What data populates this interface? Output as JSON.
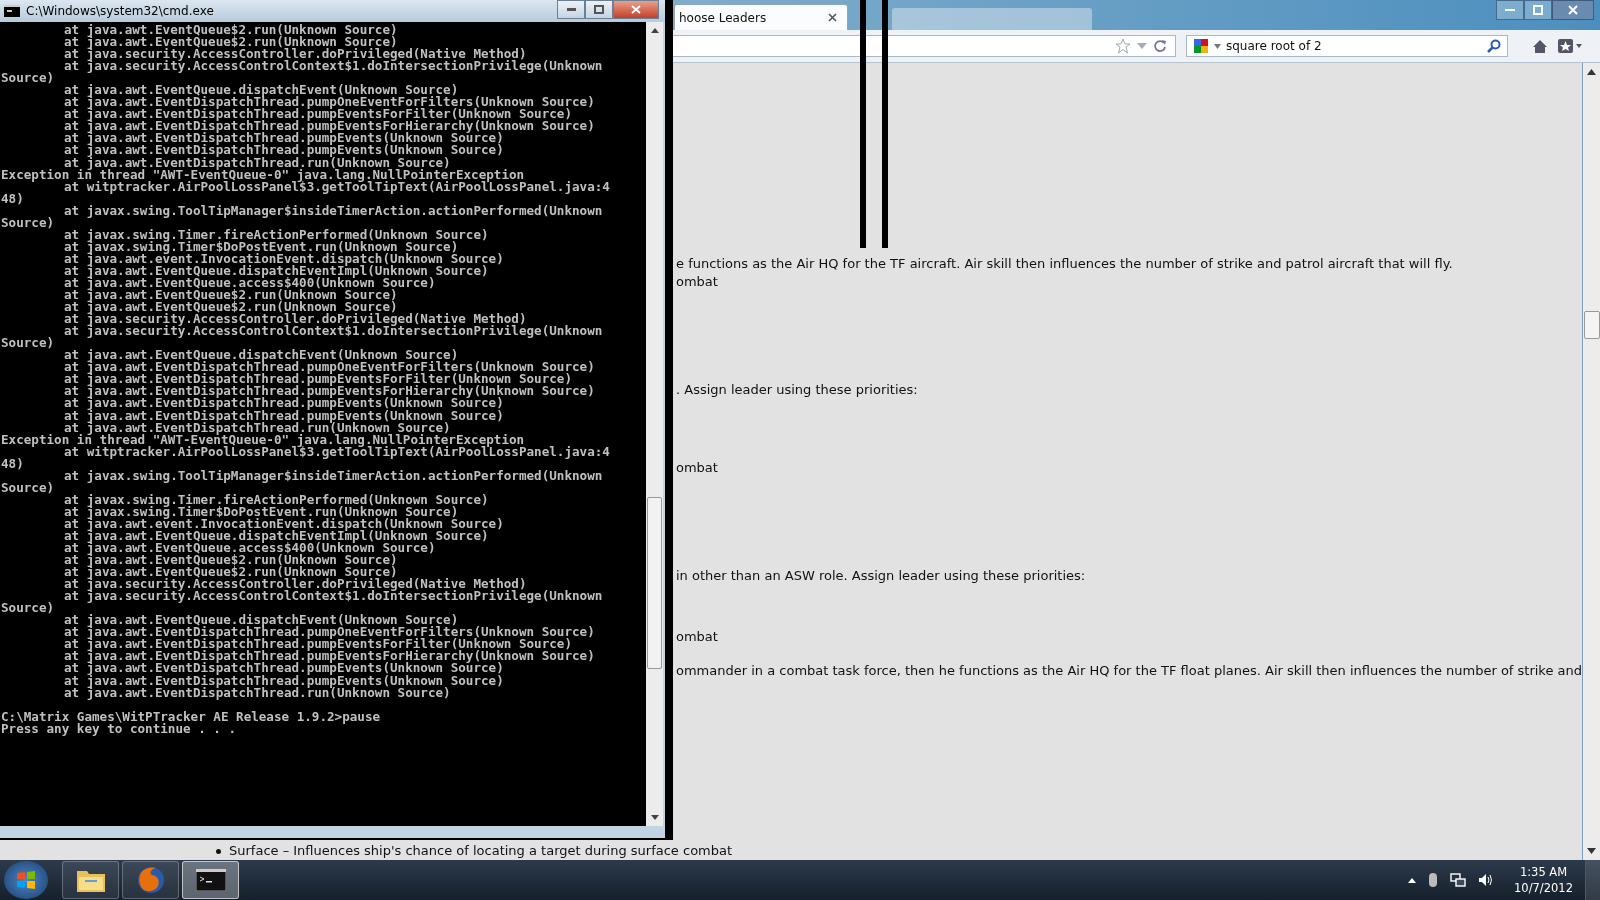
{
  "browser": {
    "tab": {
      "label": "hoose Leaders",
      "selected": true
    },
    "search_field": {
      "value": "square root of 2"
    },
    "page_lines": [
      {
        "text": "e functions as the Air HQ for the TF aircraft. Air skill then influences the number of strike and patrol aircraft that will fly."
      },
      {
        "text": "ombat"
      },
      {
        "text": ". Assign leader using these priorities:"
      },
      {
        "text": "ombat"
      },
      {
        "text": "in other than an ASW role. Assign leader using these priorities:"
      },
      {
        "text": "ombat"
      },
      {
        "text": "ommander in a combat task force, then he functions as the Air HQ for the TF float planes. Air skill then influences the number of strike and"
      }
    ],
    "bullet": {
      "text": "Surface – Influences ship's chance of locating a target during surface combat"
    }
  },
  "console_window": {
    "title": "C:\\Windows\\system32\\cmd.exe",
    "lines": [
      {
        "kind": "frame",
        "text": "at java.awt.EventQueue$2.run(Unknown Source)"
      },
      {
        "kind": "frame",
        "text": "at java.awt.EventQueue$2.run(Unknown Source)"
      },
      {
        "kind": "frame",
        "text": "at java.security.AccessController.doPrivileged(Native Method)"
      },
      {
        "kind": "frame",
        "text": "at java.security.AccessControlContext$1.doIntersectionPrivilege(Unknown"
      },
      {
        "kind": "plain",
        "text": "Source)"
      },
      {
        "kind": "frame",
        "text": "at java.awt.EventQueue.dispatchEvent(Unknown Source)"
      },
      {
        "kind": "frame",
        "text": "at java.awt.EventDispatchThread.pumpOneEventForFilters(Unknown Source)"
      },
      {
        "kind": "frame",
        "text": "at java.awt.EventDispatchThread.pumpEventsForFilter(Unknown Source)"
      },
      {
        "kind": "frame",
        "text": "at java.awt.EventDispatchThread.pumpEventsForHierarchy(Unknown Source)"
      },
      {
        "kind": "frame",
        "text": "at java.awt.EventDispatchThread.pumpEvents(Unknown Source)"
      },
      {
        "kind": "frame",
        "text": "at java.awt.EventDispatchThread.pumpEvents(Unknown Source)"
      },
      {
        "kind": "frame",
        "text": "at java.awt.EventDispatchThread.run(Unknown Source)"
      },
      {
        "kind": "plain",
        "text": "Exception in thread \"AWT-EventQueue-0\" java.lang.NullPointerException"
      },
      {
        "kind": "frame",
        "text": "at witptracker.AirPoolLossPanel$3.getToolTipText(AirPoolLossPanel.java:4"
      },
      {
        "kind": "plain",
        "text": "48)"
      },
      {
        "kind": "frame",
        "text": "at javax.swing.ToolTipManager$insideTimerAction.actionPerformed(Unknown"
      },
      {
        "kind": "plain",
        "text": "Source)"
      },
      {
        "kind": "frame",
        "text": "at javax.swing.Timer.fireActionPerformed(Unknown Source)"
      },
      {
        "kind": "frame",
        "text": "at javax.swing.Timer$DoPostEvent.run(Unknown Source)"
      },
      {
        "kind": "frame",
        "text": "at java.awt.event.InvocationEvent.dispatch(Unknown Source)"
      },
      {
        "kind": "frame",
        "text": "at java.awt.EventQueue.dispatchEventImpl(Unknown Source)"
      },
      {
        "kind": "frame",
        "text": "at java.awt.EventQueue.access$400(Unknown Source)"
      },
      {
        "kind": "frame",
        "text": "at java.awt.EventQueue$2.run(Unknown Source)"
      },
      {
        "kind": "frame",
        "text": "at java.awt.EventQueue$2.run(Unknown Source)"
      },
      {
        "kind": "frame",
        "text": "at java.security.AccessController.doPrivileged(Native Method)"
      },
      {
        "kind": "frame",
        "text": "at java.security.AccessControlContext$1.doIntersectionPrivilege(Unknown"
      },
      {
        "kind": "plain",
        "text": "Source)"
      },
      {
        "kind": "frame",
        "text": "at java.awt.EventQueue.dispatchEvent(Unknown Source)"
      },
      {
        "kind": "frame",
        "text": "at java.awt.EventDispatchThread.pumpOneEventForFilters(Unknown Source)"
      },
      {
        "kind": "frame",
        "text": "at java.awt.EventDispatchThread.pumpEventsForFilter(Unknown Source)"
      },
      {
        "kind": "frame",
        "text": "at java.awt.EventDispatchThread.pumpEventsForHierarchy(Unknown Source)"
      },
      {
        "kind": "frame",
        "text": "at java.awt.EventDispatchThread.pumpEvents(Unknown Source)"
      },
      {
        "kind": "frame",
        "text": "at java.awt.EventDispatchThread.pumpEvents(Unknown Source)"
      },
      {
        "kind": "frame",
        "text": "at java.awt.EventDispatchThread.run(Unknown Source)"
      },
      {
        "kind": "plain",
        "text": "Exception in thread \"AWT-EventQueue-0\" java.lang.NullPointerException"
      },
      {
        "kind": "frame",
        "text": "at witptracker.AirPoolLossPanel$3.getToolTipText(AirPoolLossPanel.java:4"
      },
      {
        "kind": "plain",
        "text": "48)"
      },
      {
        "kind": "frame",
        "text": "at javax.swing.ToolTipManager$insideTimerAction.actionPerformed(Unknown"
      },
      {
        "kind": "plain",
        "text": "Source)"
      },
      {
        "kind": "frame",
        "text": "at javax.swing.Timer.fireActionPerformed(Unknown Source)"
      },
      {
        "kind": "frame",
        "text": "at javax.swing.Timer$DoPostEvent.run(Unknown Source)"
      },
      {
        "kind": "frame",
        "text": "at java.awt.event.InvocationEvent.dispatch(Unknown Source)"
      },
      {
        "kind": "frame",
        "text": "at java.awt.EventQueue.dispatchEventImpl(Unknown Source)"
      },
      {
        "kind": "frame",
        "text": "at java.awt.EventQueue.access$400(Unknown Source)"
      },
      {
        "kind": "frame",
        "text": "at java.awt.EventQueue$2.run(Unknown Source)"
      },
      {
        "kind": "frame",
        "text": "at java.awt.EventQueue$2.run(Unknown Source)"
      },
      {
        "kind": "frame",
        "text": "at java.security.AccessController.doPrivileged(Native Method)"
      },
      {
        "kind": "frame",
        "text": "at java.security.AccessControlContext$1.doIntersectionPrivilege(Unknown"
      },
      {
        "kind": "plain",
        "text": "Source)"
      },
      {
        "kind": "frame",
        "text": "at java.awt.EventQueue.dispatchEvent(Unknown Source)"
      },
      {
        "kind": "frame",
        "text": "at java.awt.EventDispatchThread.pumpOneEventForFilters(Unknown Source)"
      },
      {
        "kind": "frame",
        "text": "at java.awt.EventDispatchThread.pumpEventsForFilter(Unknown Source)"
      },
      {
        "kind": "frame",
        "text": "at java.awt.EventDispatchThread.pumpEventsForHierarchy(Unknown Source)"
      },
      {
        "kind": "frame",
        "text": "at java.awt.EventDispatchThread.pumpEvents(Unknown Source)"
      },
      {
        "kind": "frame",
        "text": "at java.awt.EventDispatchThread.pumpEvents(Unknown Source)"
      },
      {
        "kind": "frame",
        "text": "at java.awt.EventDispatchThread.run(Unknown Source)"
      },
      {
        "kind": "blank"
      },
      {
        "kind": "plain",
        "text": "C:\\Matrix Games\\WitPTracker AE Release 1.9.2>pause"
      },
      {
        "kind": "plain",
        "text": "Press any key to continue . . ."
      }
    ]
  },
  "taskbar": {
    "apps": [
      {
        "kind": "folder",
        "selected": false
      },
      {
        "kind": "browser",
        "selected": false
      },
      {
        "kind": "console",
        "selected": true
      }
    ],
    "clock": {
      "time": "1:35 AM",
      "date": "10/7/2012"
    }
  }
}
